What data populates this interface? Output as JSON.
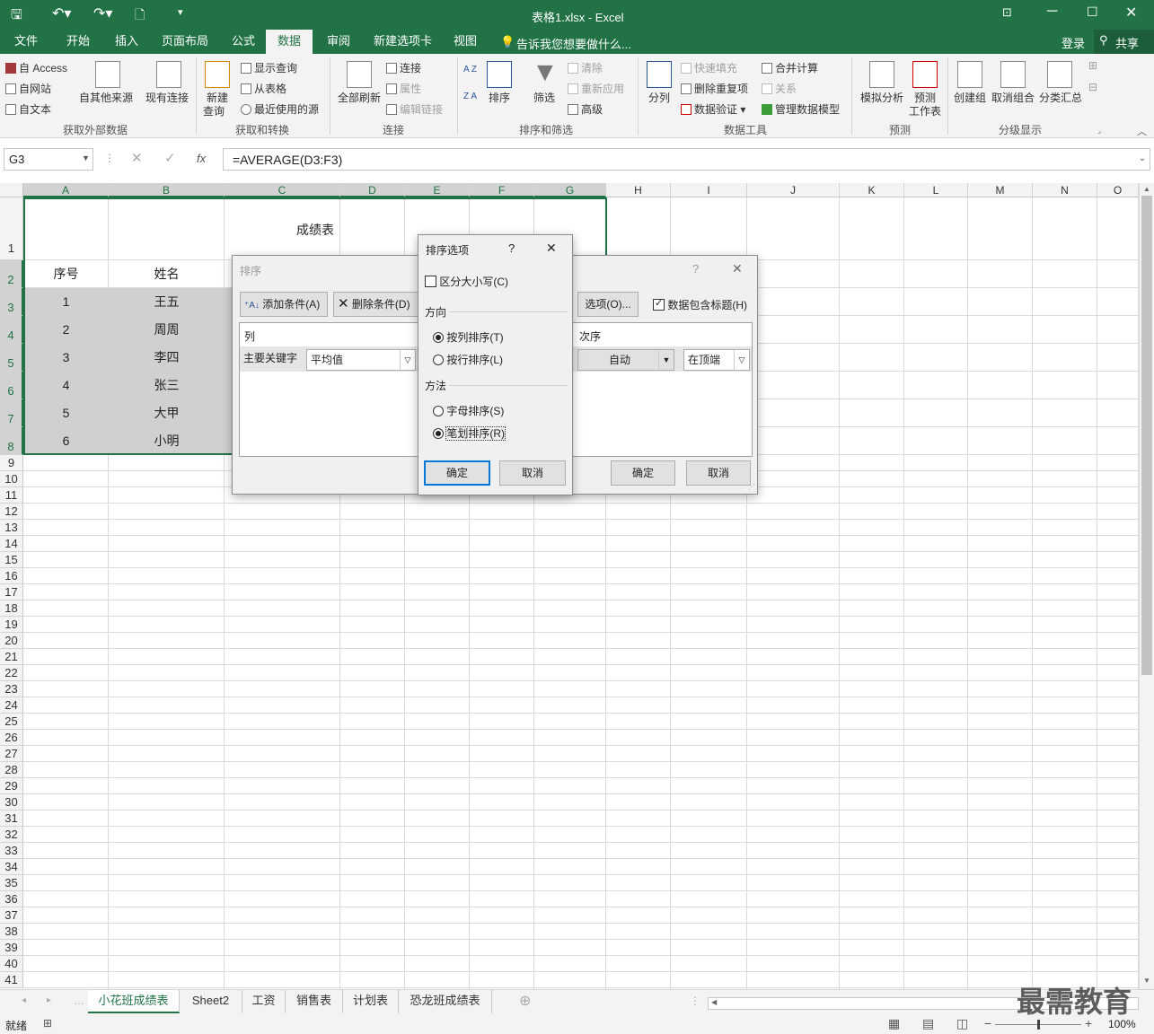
{
  "title": "表格1.xlsx - Excel",
  "menu": {
    "tabs": [
      "文件",
      "开始",
      "插入",
      "页面布局",
      "公式",
      "数据",
      "审阅",
      "新建选项卡",
      "视图"
    ],
    "active": "数据",
    "tell_me": "告诉我您想要做什么...",
    "login": "登录",
    "share": "共享"
  },
  "ribbon": {
    "ext": {
      "access": "自 Access",
      "web": "自网站",
      "text": "自文本",
      "other": "自其他来源",
      "existing": "现有连接",
      "group": "获取外部数据"
    },
    "transform": {
      "new_query": "新建",
      "new_query2": "查询",
      "show_query": "显示查询",
      "from_table": "从表格",
      "recent": "最近使用的源",
      "group": "获取和转换"
    },
    "conn": {
      "refresh": "全部刷新",
      "connections": "连接",
      "properties": "属性",
      "edit_links": "编辑链接",
      "group": "连接"
    },
    "sort": {
      "az": "A Z",
      "za": "Z A",
      "sort": "排序",
      "filter": "筛选",
      "clear": "清除",
      "reapply": "重新应用",
      "advanced": "高级",
      "group": "排序和筛选"
    },
    "tools": {
      "split": "分列",
      "flash": "快速填充",
      "remove_dup": "删除重复项",
      "validation": "数据验证",
      "consolidate": "合并计算",
      "relations": "关系",
      "model": "管理数据模型",
      "group": "数据工具"
    },
    "forecast": {
      "whatif": "模拟分析",
      "sheet": "预测",
      "sheet2": "工作表",
      "group": "预测"
    },
    "outline": {
      "group_btn": "创建组",
      "ungroup": "取消组合",
      "subtotal": "分类汇总",
      "group": "分级显示"
    }
  },
  "formula_bar": {
    "name_box": "G3",
    "fx": "fx",
    "formula": "=AVERAGE(D3:F3)"
  },
  "columns": [
    "A",
    "B",
    "C",
    "D",
    "E",
    "F",
    "G",
    "H",
    "I",
    "J",
    "K",
    "L",
    "M",
    "N",
    "O"
  ],
  "rows": [
    "1",
    "2",
    "3",
    "4",
    "5",
    "6",
    "7",
    "8",
    "9",
    "10",
    "11",
    "12",
    "13",
    "14",
    "15",
    "16",
    "17",
    "18",
    "19",
    "20",
    "21",
    "22",
    "23",
    "24",
    "25",
    "26",
    "27",
    "28",
    "29",
    "30",
    "31",
    "32",
    "33",
    "34",
    "35",
    "36",
    "37",
    "38",
    "39",
    "40",
    "41"
  ],
  "table": {
    "title": "成绩表",
    "headers": [
      "序号",
      "姓名"
    ],
    "rows": [
      [
        "1",
        "王五"
      ],
      [
        "2",
        "周周"
      ],
      [
        "3",
        "李四"
      ],
      [
        "4",
        "张三"
      ],
      [
        "5",
        "大甲"
      ],
      [
        "6",
        "小明"
      ]
    ]
  },
  "sort_dialog": {
    "title": "排序",
    "help": "?",
    "close": "✕",
    "add": "添加条件(A)",
    "delete": "删除条件(D)",
    "options": "选项(O)...",
    "has_header": "数据包含标题(H)",
    "col_header": "列",
    "order_header": "次序",
    "primary_label": "主要关键字",
    "primary_value": "平均值",
    "auto": "自动",
    "order_value": "在顶端",
    "ok": "确定",
    "cancel": "取消"
  },
  "options_dialog": {
    "title": "排序选项",
    "help": "?",
    "close": "✕",
    "case": "区分大小写(C)",
    "direction": "方向",
    "by_col": "按列排序(T)",
    "by_row": "按行排序(L)",
    "method": "方法",
    "alpha": "字母排序(S)",
    "stroke": "笔划排序(R)",
    "ok": "确定",
    "cancel": "取消"
  },
  "sheets": [
    "小花班成绩表",
    "Sheet2",
    "工资",
    "销售表",
    "计划表",
    "恐龙班成绩表"
  ],
  "active_sheet": "小花班成绩表",
  "status": {
    "ready": "就绪",
    "zoom": "100%"
  },
  "watermark": "最需教育",
  "colors": {
    "excel_green": "#217346",
    "selection_gray": "#bfbfbf",
    "dialog_bg": "#f0f0f0",
    "focus_blue": "#0078d7"
  }
}
